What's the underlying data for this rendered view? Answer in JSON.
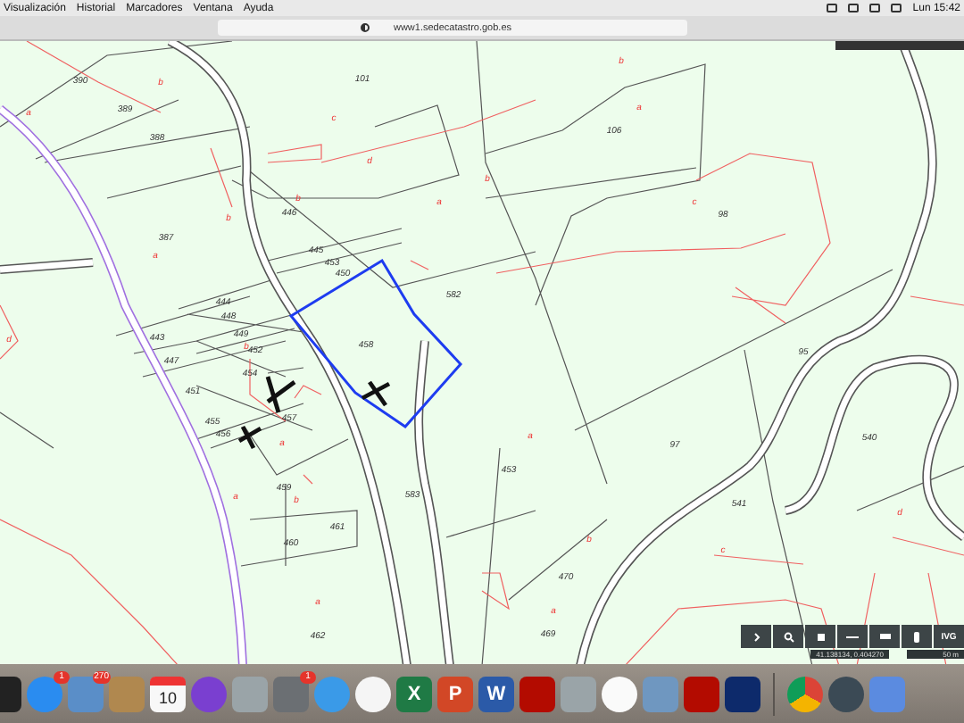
{
  "menu_bar": {
    "items": [
      "Visualización",
      "Historial",
      "Marcadores",
      "Ventana",
      "Ayuda"
    ],
    "clock": "Lun 15:42"
  },
  "browser": {
    "url": "www1.sedecatastro.gob.es"
  },
  "map": {
    "parcel_labels": [
      "390",
      "389",
      "388",
      "101",
      "106",
      "98",
      "387",
      "446",
      "445",
      "453",
      "450",
      "582",
      "444",
      "443",
      "448",
      "449",
      "452",
      "447",
      "454",
      "451",
      "458",
      "455",
      "456",
      "457",
      "459",
      "461",
      "460",
      "583",
      "453",
      "95",
      "97",
      "540",
      "541",
      "470",
      "469",
      "462"
    ],
    "letters": [
      "a",
      "b",
      "c",
      "d",
      "a",
      "b",
      "a",
      "b",
      "d",
      "b",
      "a",
      "a",
      "b",
      "a",
      "b",
      "a",
      "b",
      "c",
      "a",
      "b",
      "c",
      "d",
      "a"
    ],
    "coordinates": "41.138134, 0.404270",
    "scale": "50 m",
    "tool_label": "IVG"
  },
  "dock_items": [
    {
      "kind": "terminal"
    },
    {
      "kind": "appstore",
      "badge": "1"
    },
    {
      "kind": "mailbird",
      "badge": "270"
    },
    {
      "kind": "contacts"
    },
    {
      "kind": "calendar",
      "label": "10"
    },
    {
      "kind": "star"
    },
    {
      "kind": "blocked"
    },
    {
      "kind": "settings",
      "badge": "1"
    },
    {
      "kind": "safari"
    },
    {
      "kind": "photos"
    },
    {
      "kind": "excel",
      "label": "X"
    },
    {
      "kind": "powerpoint",
      "label": "P"
    },
    {
      "kind": "word",
      "label": "W"
    },
    {
      "kind": "pdf"
    },
    {
      "kind": "blocked"
    },
    {
      "kind": "music"
    },
    {
      "kind": "preview"
    },
    {
      "kind": "pdf"
    },
    {
      "kind": "teamviewer"
    },
    {
      "kind": "divider"
    },
    {
      "kind": "chrome"
    },
    {
      "kind": "quicktime"
    },
    {
      "kind": "finder"
    }
  ]
}
